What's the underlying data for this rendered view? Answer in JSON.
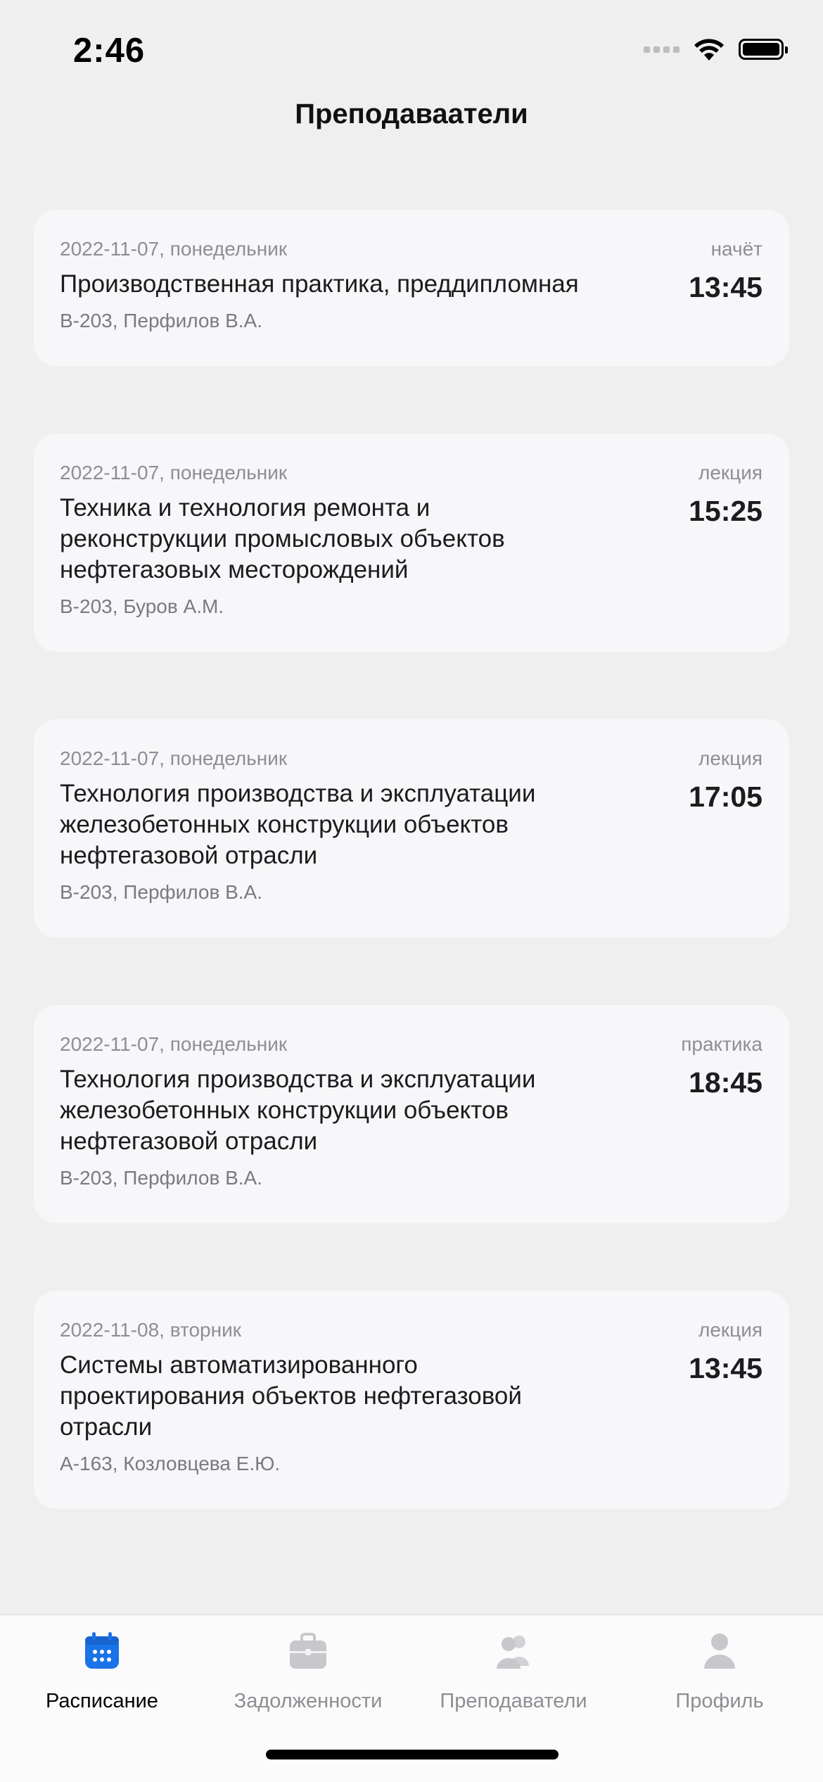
{
  "status_bar": {
    "time": "2:46"
  },
  "header": {
    "title": "Преподаваатели"
  },
  "lessons": [
    {
      "date": "2022-11-07, понедельник",
      "subject": "Производственная практика, преддипломная",
      "room_teacher": "В-203, Перфилов В.А.",
      "type": "начёт",
      "time": "13:45"
    },
    {
      "date": "2022-11-07, понедельник",
      "subject": "Техника и технология ремонта и реконструкции промысловых  объектов нефтегазовых месторождений",
      "room_teacher": "В-203, Буров А.М.",
      "type": "лекция",
      "time": "15:25"
    },
    {
      "date": "2022-11-07, понедельник",
      "subject": "Технология производства и эксплуатации железобетонных конструкции объектов нефтегазовой отрасли",
      "room_teacher": "В-203, Перфилов В.А.",
      "type": "лекция",
      "time": "17:05"
    },
    {
      "date": "2022-11-07, понедельник",
      "subject": "Технология производства и эксплуатации железобетонных конструкции объектов нефтегазовой отрасли",
      "room_teacher": "В-203, Перфилов В.А.",
      "type": "практика",
      "time": "18:45"
    },
    {
      "date": "2022-11-08, вторник",
      "subject": "Системы автоматизированного проектирования  объектов нефтегазовой отрасли",
      "room_teacher": "А-163, Козловцева Е.Ю.",
      "type": "лекция",
      "time": "13:45"
    }
  ],
  "tab_bar": {
    "tabs": [
      {
        "label": "Расписание",
        "icon": "calendar-icon",
        "active": true
      },
      {
        "label": "Задолженности",
        "icon": "briefcase-icon",
        "active": false
      },
      {
        "label": "Преподаватели",
        "icon": "people-icon",
        "active": false
      },
      {
        "label": "Профиль",
        "icon": "person-icon",
        "active": false
      }
    ]
  },
  "colors": {
    "accent": "#1a73e8",
    "inactive_icon": "#c7c7cc",
    "background": "#efefef",
    "card": "#f7f7f9"
  }
}
